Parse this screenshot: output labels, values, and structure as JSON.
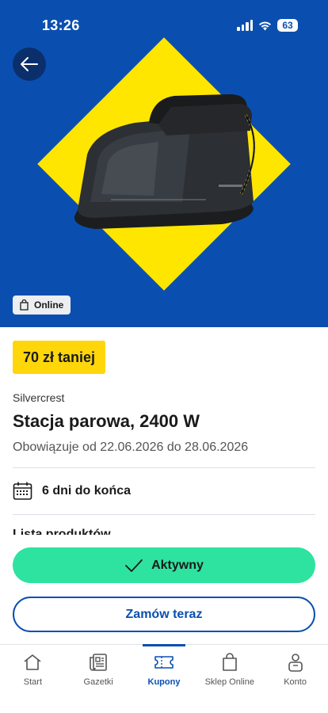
{
  "status_bar": {
    "time": "13:26",
    "battery": "63"
  },
  "hero": {
    "badge_label": "Online"
  },
  "product": {
    "discount": "70 zł taniej",
    "brand": "Silvercrest",
    "title": "Stacja parowa, 2400 W",
    "validity": "Obowiązuje od 22.06.2026 do 28.06.2026",
    "days_left": "6 dni do końca",
    "cut_off_heading": "Lista produktów"
  },
  "actions": {
    "active_label": "Aktywny",
    "order_label": "Zamów teraz"
  },
  "nav": {
    "items": [
      {
        "label": "Start",
        "icon": "home-icon"
      },
      {
        "label": "Gazetki",
        "icon": "leaflet-icon"
      },
      {
        "label": "Kupony",
        "icon": "coupon-icon"
      },
      {
        "label": "Sklep Online",
        "icon": "shopping-bag-icon"
      },
      {
        "label": "Konto",
        "icon": "account-icon"
      }
    ],
    "active_index": 2
  },
  "colors": {
    "brand_blue": "#0a4fb0",
    "yellow": "#ffe600",
    "discount_yellow": "#ffd60a",
    "active_green": "#2ee3a0"
  }
}
